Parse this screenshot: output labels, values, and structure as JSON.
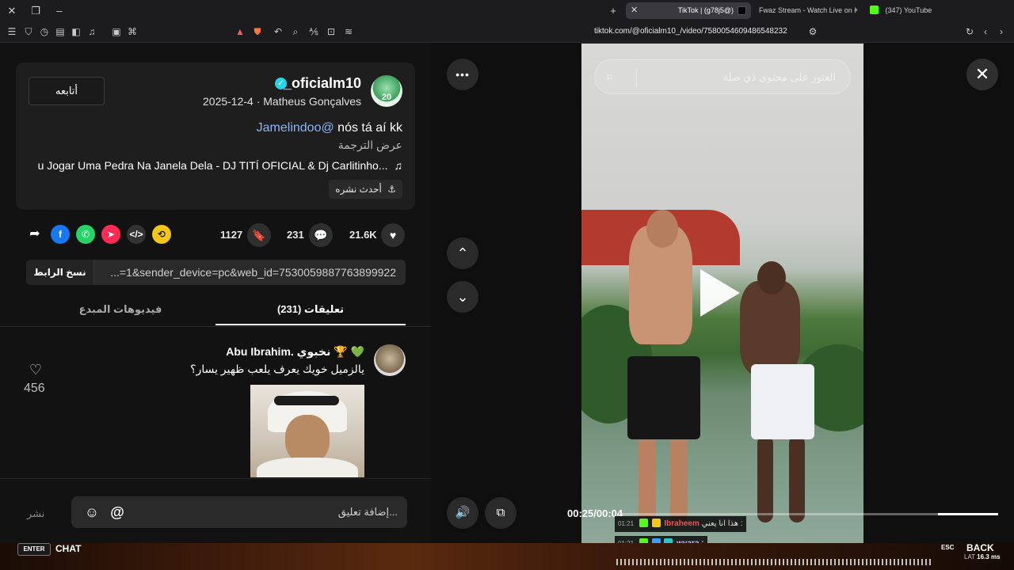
{
  "browser": {
    "tabs": [
      {
        "label": "TikTok | (g78j5@)",
        "active": true
      },
      {
        "label": "Fwaz Stream - Watch Live on Kick",
        "active": false
      },
      {
        "label": "(347) YouTube",
        "active": false
      }
    ],
    "url": "tiktok.com/@oficialm10_/video/7580054609486548232",
    "new_tab": "+"
  },
  "post": {
    "follow_label": "أتابعه",
    "username": "_oficialm10",
    "verified": "✓",
    "meta": "2025-12-4 · Matheus Gonçalves",
    "caption_text": "nós tá aí kk",
    "caption_mention": "Jamelindoo@",
    "translate_label": "عرض الترجمة",
    "music": "u Jogar Uma Pedra Na Janela Dela - DJ TITÍ OFICIAL & Dj Carlitinho...",
    "recent_label": "أحدث نشره",
    "avatar_number": "20"
  },
  "stats": {
    "likes": "21.6K",
    "comments": "231",
    "saves": "1127"
  },
  "share": {
    "copy_label": "نسخ الرابط",
    "link": "...=1&sender_device=pc&web_id=7530059887763899922"
  },
  "tabs": {
    "comments_label": "تعليقات (231)",
    "creator_videos_label": "فيديوهات المبدع"
  },
  "comment": {
    "name": "Abu Ibrahim. نخبوي 🏆 💚",
    "text": "يالزميل خويك يعرف يلعب ظهير يسار؟",
    "likes": "456"
  },
  "composer": {
    "placeholder": "إضافة تعليق...",
    "post_label": "نشر",
    "mention": "@",
    "emoji": "☺"
  },
  "player": {
    "search_placeholder": "العثور على محتوى ذي صلة",
    "timecode": "00:25/00:04",
    "progress_fraction": 0.16,
    "more": "•••",
    "up": "⌃",
    "down": "⌄",
    "close": "✕",
    "volume": "🔊",
    "pip": "⧉"
  },
  "overlay": {
    "chat_lines": [
      {
        "time": "01:21",
        "name": "Ibraheem",
        "text": "هذا انا يعني :",
        "name_color": "#ff4d4d"
      },
      {
        "time": "01:21",
        "name": "wyara :",
        "text": "",
        "name_color": "#c9b6ff"
      }
    ],
    "enter_key": "ENTER",
    "chat_label": "CHAT",
    "esc_key": "ESC",
    "back_label": "BACK",
    "lat_label": "LAT",
    "lat_value": "16.3 ms"
  },
  "colors": {
    "accent": "#fe2c55",
    "verified": "#20d5ec",
    "mention": "#8ab4f8"
  }
}
